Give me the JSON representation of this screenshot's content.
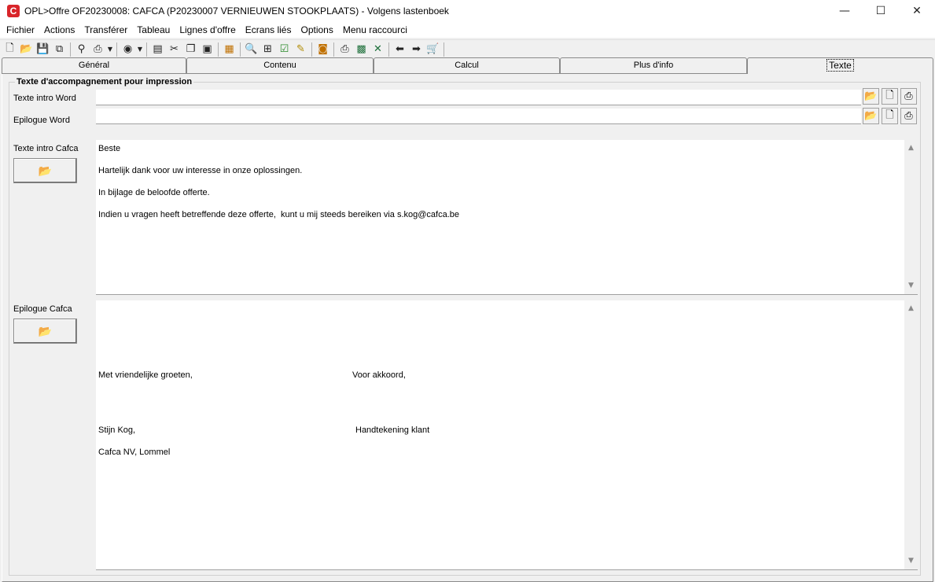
{
  "window": {
    "app_icon_letter": "C",
    "title": "OPL>Offre OF20230008: CAFCA (P20230007 VERNIEUWEN STOOKPLAATS) - Volgens lastenboek",
    "minimize": "—",
    "maximize": "☐",
    "close": "✕"
  },
  "menu": {
    "items": [
      "Fichier",
      "Actions",
      "Transférer",
      "Tableau",
      "Lignes d'offre",
      "Ecrans liés",
      "Options",
      "Menu raccourci"
    ]
  },
  "toolbar": {
    "icons": [
      "new-icon",
      "open-icon",
      "save-icon",
      "copy-doc-icon",
      "binoculars-icon",
      "print-icon",
      "globe-icon",
      "properties-icon",
      "cut-icon",
      "copy-icon",
      "paste-icon",
      "calculator-icon",
      "zoom-icon",
      "tree-icon",
      "check-icon",
      "script-icon",
      "bag-icon",
      "printer-doc-icon",
      "excel-icon",
      "excel-export-icon",
      "back-icon",
      "forward-icon",
      "cart-icon"
    ]
  },
  "tabs": [
    {
      "label": "Général",
      "active": false
    },
    {
      "label": "Contenu",
      "active": false
    },
    {
      "label": "Calcul",
      "active": false
    },
    {
      "label": "Plus d'info",
      "active": false
    },
    {
      "label": "Texte",
      "active": true
    }
  ],
  "group": {
    "title": "Texte d'accompagnement pour impression"
  },
  "fields": {
    "intro_word_label": "Texte intro Word",
    "intro_word_value": "",
    "epilogue_word_label": "Epilogue Word",
    "epilogue_word_value": "",
    "intro_cafca_label": "Texte intro Cafca",
    "epilogue_cafca_label": "Epilogue Cafca"
  },
  "intro_cafca_text": {
    "line1": "Beste",
    "line2": "Hartelijk dank voor uw interesse in onze oplossingen.",
    "line3": "In bijlage de beloofde offerte.",
    "line4": "Indien u vragen heeft betreffende deze offerte,  kunt u mij steeds bereiken via s.kog@cafca.be"
  },
  "epilogue_cafca_text": {
    "greeting": "Met vriendelijke groeten,",
    "agreement": "Voor akkoord,",
    "name": "Stijn Kog,",
    "signature": "Handtekening klant",
    "company": "Cafca NV, Lommel"
  }
}
